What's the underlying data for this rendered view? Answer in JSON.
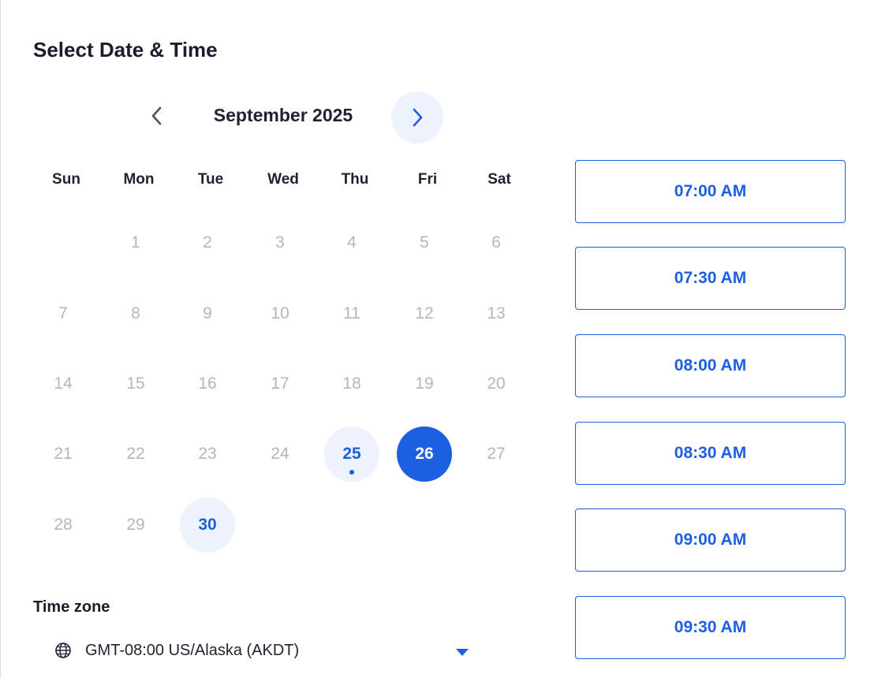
{
  "title": "Select Date & Time",
  "calendar": {
    "month_label": "September 2025",
    "prev_icon": "chevron-left-icon",
    "next_icon": "chevron-right-icon",
    "weekdays": [
      "Sun",
      "Mon",
      "Tue",
      "Wed",
      "Thu",
      "Fri",
      "Sat"
    ],
    "weeks": [
      [
        "",
        "1",
        "2",
        "3",
        "4",
        "5",
        "6"
      ],
      [
        "7",
        "8",
        "9",
        "10",
        "11",
        "12",
        "13"
      ],
      [
        "14",
        "15",
        "16",
        "17",
        "18",
        "19",
        "20"
      ],
      [
        "21",
        "22",
        "23",
        "24",
        "25",
        "26",
        "27"
      ],
      [
        "28",
        "29",
        "30",
        "",
        "",
        "",
        ""
      ]
    ],
    "today": "25",
    "selected": "26",
    "available": [
      "25",
      "26",
      "30"
    ]
  },
  "timezone": {
    "label": "Time zone",
    "value": "GMT-08:00 US/Alaska (AKDT)",
    "icon": "globe-icon"
  },
  "time_slots": [
    "07:00 AM",
    "07:30 AM",
    "08:00 AM",
    "08:30 AM",
    "09:00 AM",
    "09:30 AM"
  ],
  "colors": {
    "accent": "#1c5fe0",
    "accent_light": "#edf2fd",
    "disabled_text": "#b3b6bd"
  }
}
